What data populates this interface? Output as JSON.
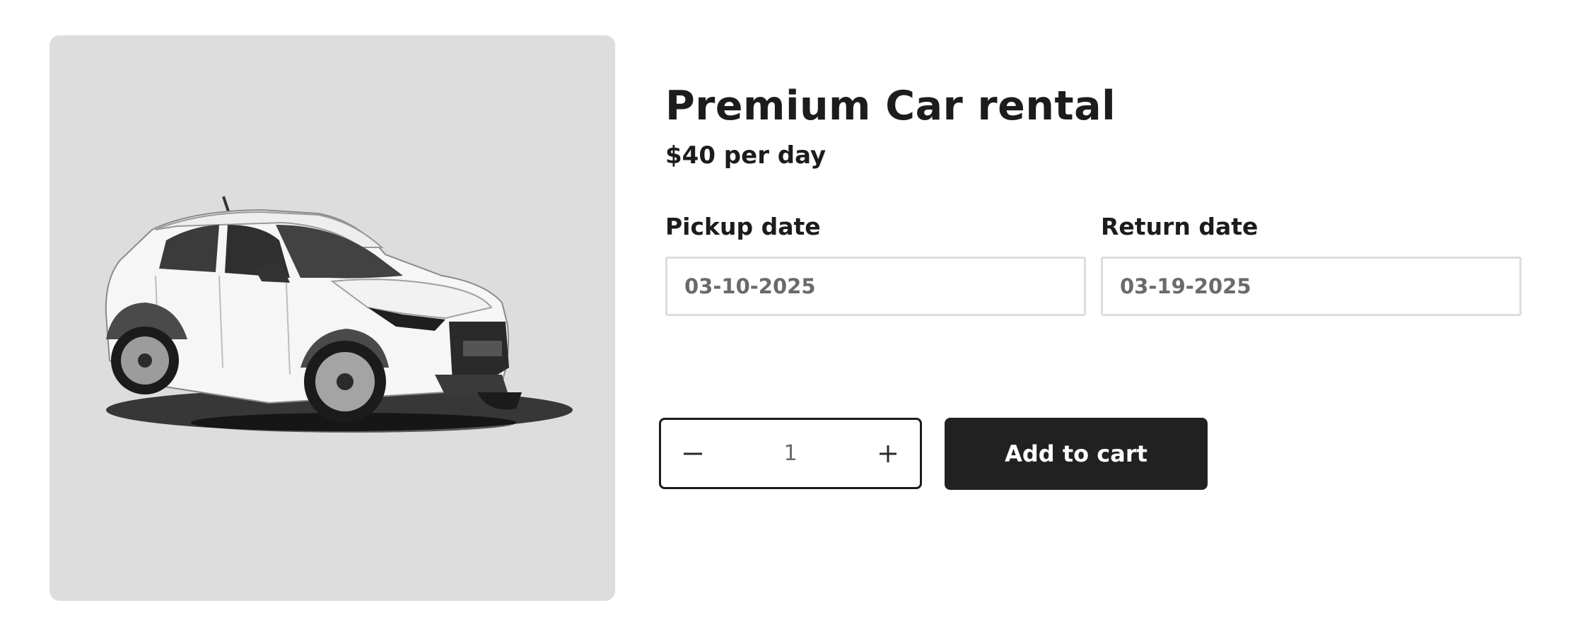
{
  "product": {
    "title": "Premium Car rental",
    "price": "$40 per day",
    "image_alt": "white-hatchback-car"
  },
  "pickup": {
    "label": "Pickup date",
    "value": "03-10-2025"
  },
  "return": {
    "label": "Return date",
    "value": "03-19-2025"
  },
  "quantity": {
    "value": "1",
    "minus_icon": "minus-icon",
    "plus_icon": "plus-icon"
  },
  "cart": {
    "add_label": "Add to cart"
  },
  "colors": {
    "image_background": "#dddddd",
    "button_background": "#212121",
    "button_text": "#ffffff",
    "input_border": "#dddddd",
    "text": "#1c1c1c"
  }
}
